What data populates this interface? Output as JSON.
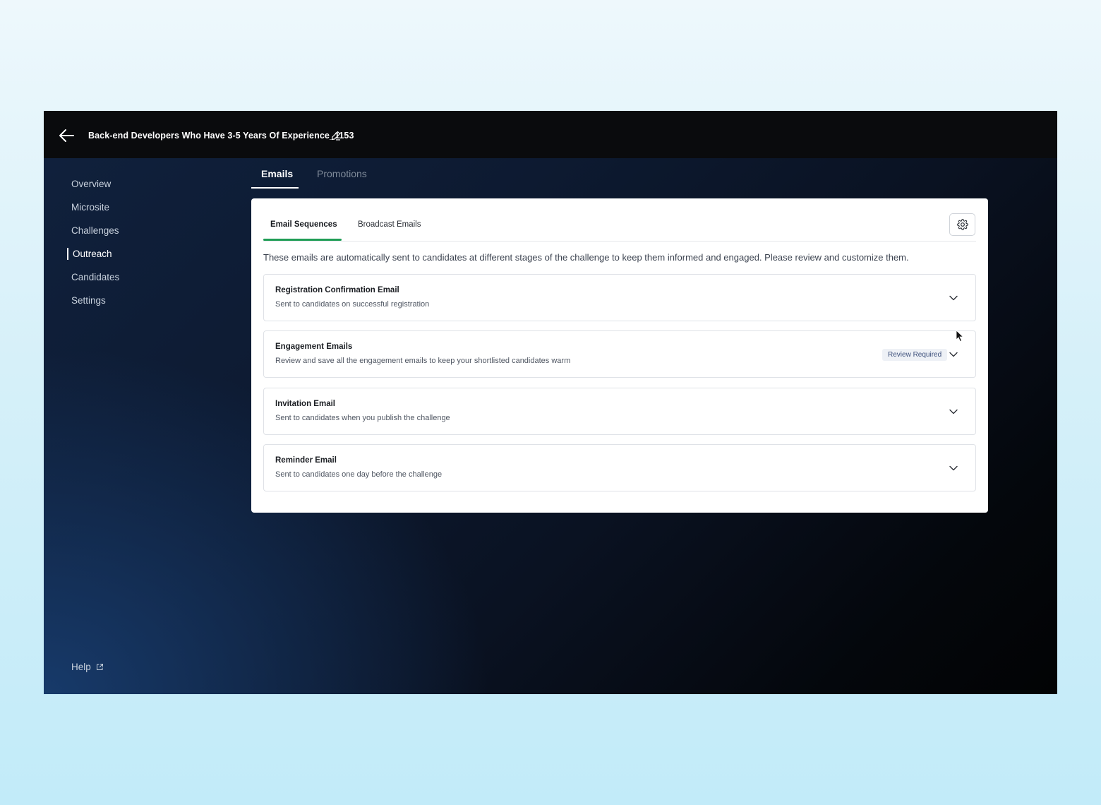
{
  "header": {
    "title": "Back-end Developers Who Have 3-5 Years Of Experience_1153"
  },
  "sidebar": {
    "items": [
      {
        "label": "Overview"
      },
      {
        "label": "Microsite"
      },
      {
        "label": "Challenges"
      },
      {
        "label": "Outreach"
      },
      {
        "label": "Candidates"
      },
      {
        "label": "Settings"
      }
    ],
    "active": "Outreach",
    "help_label": "Help"
  },
  "tabs": {
    "emails": "Emails",
    "promotions": "Promotions"
  },
  "card": {
    "subtabs": {
      "sequences": "Email Sequences",
      "broadcast": "Broadcast Emails"
    },
    "intro": "These emails are automatically sent to candidates at different stages of the challenge to keep them informed and engaged. Please review and customize them.",
    "emails": [
      {
        "title": "Registration Confirmation Email",
        "desc": "Sent to candidates on successful registration"
      },
      {
        "title": "Engagement Emails",
        "desc": "Review and save all the engagement emails to keep your shortlisted candidates warm",
        "badge": "Review Required"
      },
      {
        "title": "Invitation Email",
        "desc": "Sent to candidates when you publish the challenge"
      },
      {
        "title": "Reminder Email",
        "desc": "Sent to candidates one day before the challenge"
      }
    ]
  },
  "colors": {
    "accent_green": "#1f9d55",
    "badge_bg": "#eef1f6",
    "badge_text": "#3b4e7a"
  },
  "icons": [
    "back-arrow-icon",
    "pencil-icon",
    "external-link-icon",
    "gear-icon",
    "chevron-down-icon",
    "mouse-cursor-icon"
  ]
}
